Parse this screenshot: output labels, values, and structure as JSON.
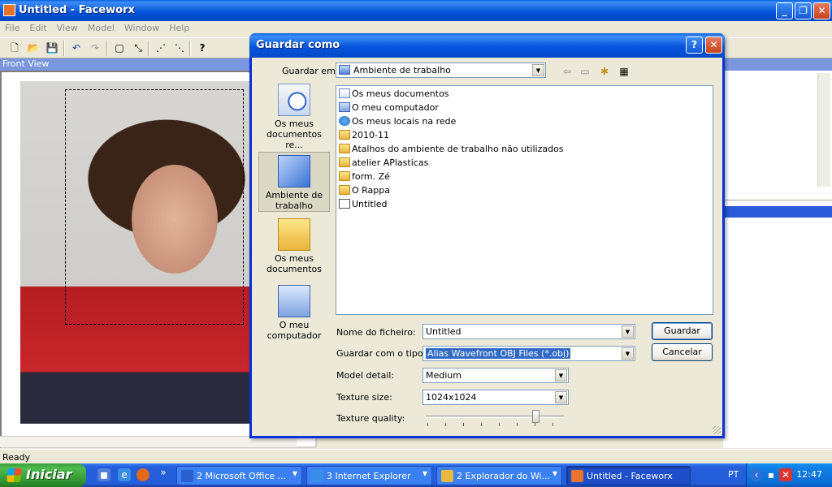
{
  "window": {
    "title": "Untitled - Faceworx",
    "min_glyph": "_",
    "max_glyph": "❐",
    "close_glyph": "✕"
  },
  "menu": [
    "File",
    "Edit",
    "View",
    "Model",
    "Window",
    "Help"
  ],
  "toolbar": {
    "new": "🗋",
    "open": "📂",
    "save": "💾",
    "undo": "↶",
    "redo": "↷",
    "select": "▢",
    "move": "⤡",
    "points1": "⋰",
    "points2": "⋱",
    "help": "?"
  },
  "front_view": {
    "label": "Front View"
  },
  "status": {
    "text": "Ready"
  },
  "dialog": {
    "title": "Guardar como",
    "help_glyph": "?",
    "close_glyph": "✕",
    "save_in_label": "Guardar em:",
    "save_in_value": "Ambiente de trabalho",
    "places": [
      {
        "label": "Os meus documentos re...",
        "icon": "recent-documents-icon"
      },
      {
        "label": "Ambiente de trabalho",
        "icon": "desktop-icon"
      },
      {
        "label": "Os meus documentos",
        "icon": "my-documents-icon"
      },
      {
        "label": "O meu computador",
        "icon": "my-computer-icon"
      }
    ],
    "files": [
      {
        "name": "Os meus documentos",
        "type": "docs"
      },
      {
        "name": "O meu computador",
        "type": "pc"
      },
      {
        "name": "Os meus locais na rede",
        "type": "net"
      },
      {
        "name": "2010-11",
        "type": "folder"
      },
      {
        "name": "Atalhos do ambiente de trabalho não utilizados",
        "type": "folder"
      },
      {
        "name": "atelier APlasticas",
        "type": "folder"
      },
      {
        "name": "form. Zé",
        "type": "folder"
      },
      {
        "name": "O Rappa",
        "type": "folder"
      },
      {
        "name": "Untitled",
        "type": "file-i"
      }
    ],
    "filename_label": "Nome do ficheiro:",
    "filename_value": "Untitled",
    "filetype_label": "Guardar com o tipo:",
    "filetype_value": "Alias Wavefront OBJ Files (*.obj)",
    "model_detail_label": "Model detail:",
    "model_detail_value": "Medium",
    "texture_size_label": "Texture size:",
    "texture_size_value": "1024x1024",
    "texture_quality_label": "Texture quality:",
    "texture_quality_level": 0.78,
    "save_button": "Guardar",
    "cancel_button": "Cancelar",
    "dropdown_glyph": "▼"
  },
  "taskbar": {
    "start_label": "Iniciar",
    "tasks": [
      {
        "label": "2 Microsoft Office ...",
        "color": "#2b5fcf"
      },
      {
        "label": "3 Internet Explorer",
        "color": "#3a8ee6"
      },
      {
        "label": "2 Explorador do Wi...",
        "color": "#e8b840"
      },
      {
        "label": "Untitled - Faceworx",
        "color": "#e8732a"
      }
    ],
    "language": "PT",
    "clock": "12:47",
    "more_glyph": "»",
    "task_arrow": "▼"
  },
  "colors": {
    "xp_blue": "#0a5fe0",
    "start_green": "#3c9c3c",
    "selection": "#316ac5"
  }
}
